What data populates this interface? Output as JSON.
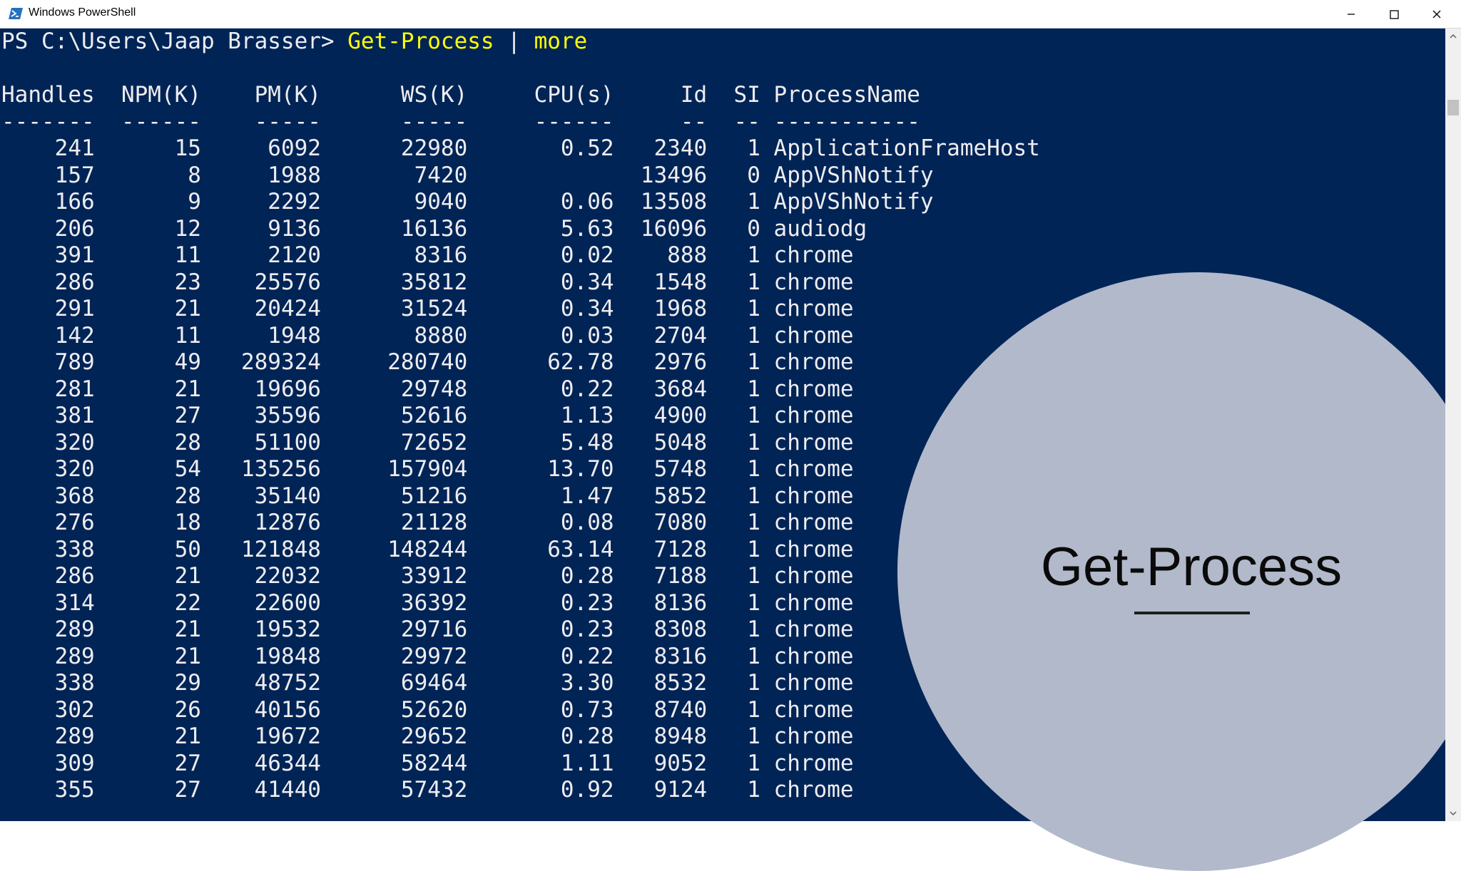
{
  "window": {
    "title": "Windows PowerShell",
    "icon": "powershell-icon",
    "controls": [
      "minimize-icon",
      "maximize-icon",
      "close-icon"
    ]
  },
  "console": {
    "prompt": "PS C:\\Users\\Jaap Brasser> ",
    "command": "Get-Process",
    "pipe": " | ",
    "pipe_command": "more",
    "headers": [
      "Handles",
      "NPM(K)",
      "PM(K)",
      "WS(K)",
      "CPU(s)",
      "Id",
      "SI",
      "ProcessName"
    ],
    "rows": [
      [
        "241",
        "15",
        "6092",
        "22980",
        "0.52",
        "2340",
        "1",
        "ApplicationFrameHost"
      ],
      [
        "157",
        "8",
        "1988",
        "7420",
        "",
        "13496",
        "0",
        "AppVShNotify"
      ],
      [
        "166",
        "9",
        "2292",
        "9040",
        "0.06",
        "13508",
        "1",
        "AppVShNotify"
      ],
      [
        "206",
        "12",
        "9136",
        "16136",
        "5.63",
        "16096",
        "0",
        "audiodg"
      ],
      [
        "391",
        "11",
        "2120",
        "8316",
        "0.02",
        "888",
        "1",
        "chrome"
      ],
      [
        "286",
        "23",
        "25576",
        "35812",
        "0.34",
        "1548",
        "1",
        "chrome"
      ],
      [
        "291",
        "21",
        "20424",
        "31524",
        "0.34",
        "1968",
        "1",
        "chrome"
      ],
      [
        "142",
        "11",
        "1948",
        "8880",
        "0.03",
        "2704",
        "1",
        "chrome"
      ],
      [
        "789",
        "49",
        "289324",
        "280740",
        "62.78",
        "2976",
        "1",
        "chrome"
      ],
      [
        "281",
        "21",
        "19696",
        "29748",
        "0.22",
        "3684",
        "1",
        "chrome"
      ],
      [
        "381",
        "27",
        "35596",
        "52616",
        "1.13",
        "4900",
        "1",
        "chrome"
      ],
      [
        "320",
        "28",
        "51100",
        "72652",
        "5.48",
        "5048",
        "1",
        "chrome"
      ],
      [
        "320",
        "54",
        "135256",
        "157904",
        "13.70",
        "5748",
        "1",
        "chrome"
      ],
      [
        "368",
        "28",
        "35140",
        "51216",
        "1.47",
        "5852",
        "1",
        "chrome"
      ],
      [
        "276",
        "18",
        "12876",
        "21128",
        "0.08",
        "7080",
        "1",
        "chrome"
      ],
      [
        "338",
        "50",
        "121848",
        "148244",
        "63.14",
        "7128",
        "1",
        "chrome"
      ],
      [
        "286",
        "21",
        "22032",
        "33912",
        "0.28",
        "7188",
        "1",
        "chrome"
      ],
      [
        "314",
        "22",
        "22600",
        "36392",
        "0.23",
        "8136",
        "1",
        "chrome"
      ],
      [
        "289",
        "21",
        "19532",
        "29716",
        "0.23",
        "8308",
        "1",
        "chrome"
      ],
      [
        "289",
        "21",
        "19848",
        "29972",
        "0.22",
        "8316",
        "1",
        "chrome"
      ],
      [
        "338",
        "29",
        "48752",
        "69464",
        "3.30",
        "8532",
        "1",
        "chrome"
      ],
      [
        "302",
        "26",
        "40156",
        "52620",
        "0.73",
        "8740",
        "1",
        "chrome"
      ],
      [
        "289",
        "21",
        "19672",
        "29652",
        "0.28",
        "8948",
        "1",
        "chrome"
      ],
      [
        "309",
        "27",
        "46344",
        "58244",
        "1.11",
        "9052",
        "1",
        "chrome"
      ],
      [
        "355",
        "27",
        "41440",
        "57432",
        "0.92",
        "9124",
        "1",
        "chrome"
      ]
    ]
  },
  "overlay": {
    "title": "Get-Process"
  },
  "colors": {
    "console_bg": "#012456",
    "console_text": "#eeedf0",
    "command_text": "#ffff00",
    "circle": "#b1b9cb"
  }
}
